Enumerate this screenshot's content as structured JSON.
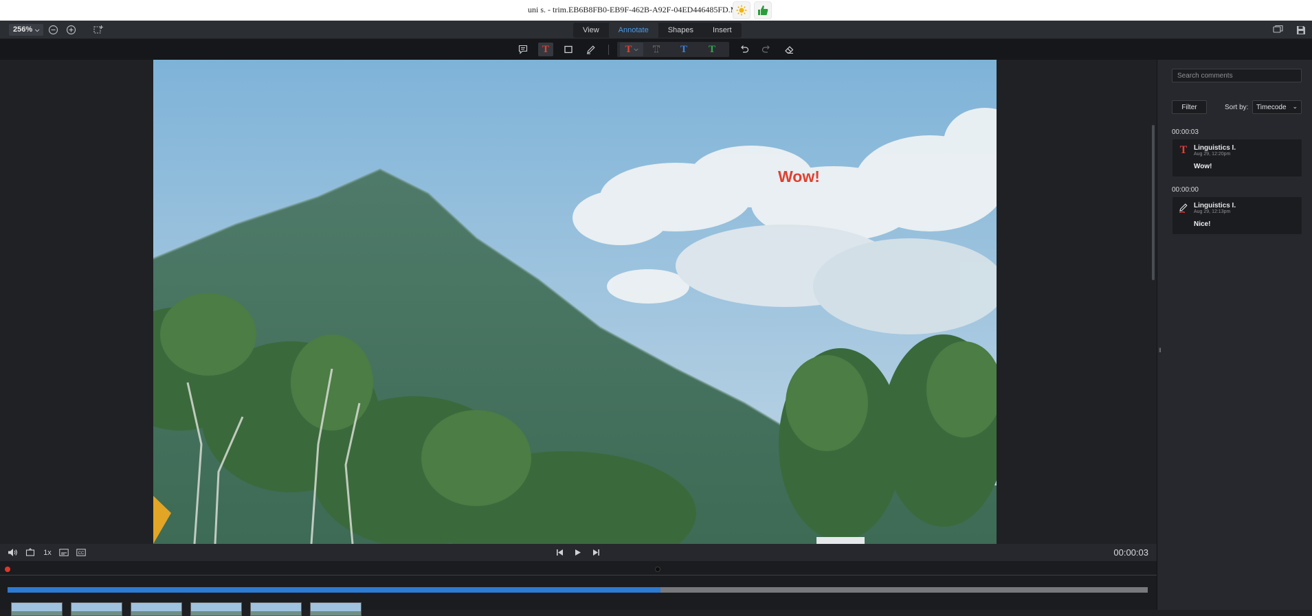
{
  "window": {
    "title": "uni s. - trim.EB6B8FB0-EB9F-462B-A92F-04ED446485FD.MOV"
  },
  "topbar": {
    "zoom_label": "256%",
    "tabs": [
      {
        "label": "View",
        "active": false
      },
      {
        "label": "Annotate",
        "active": true
      },
      {
        "label": "Shapes",
        "active": false
      },
      {
        "label": "Insert",
        "active": false
      }
    ]
  },
  "toolbar": {
    "tools": [
      "comment-icon",
      "text-tool-icon",
      "rectangle-icon",
      "pen-icon"
    ],
    "text_colors": [
      "#e04032",
      "#2b2b2b",
      "#3d7ee0",
      "#2fa84f"
    ],
    "actions": [
      "undo-icon",
      "redo-icon",
      "eraser-icon"
    ]
  },
  "canvas": {
    "annotation_text": "Wow!",
    "annotation_color": "#e04032"
  },
  "comments_panel": {
    "search_placeholder": "Search comments",
    "filter_label": "Filter",
    "sort_label": "Sort by:",
    "sort_value": "Timecode",
    "groups": [
      {
        "timecode": "00:00:03",
        "comment": {
          "type": "text-icon",
          "author": "Linguistics I.",
          "date": "Aug 29, 12:20pm",
          "text": "Wow!"
        }
      },
      {
        "timecode": "00:00:00",
        "comment": {
          "type": "pen-icon",
          "author": "Linguistics I.",
          "date": "Aug 29, 12:13pm",
          "text": "Nice!"
        }
      }
    ]
  },
  "player": {
    "speed_label": "1x",
    "timecode": "00:00:03",
    "progress": 0.5727
  },
  "colors": {
    "accent": "#4a9be8",
    "progress": "#2d7ad2",
    "record": "#e0362c"
  }
}
